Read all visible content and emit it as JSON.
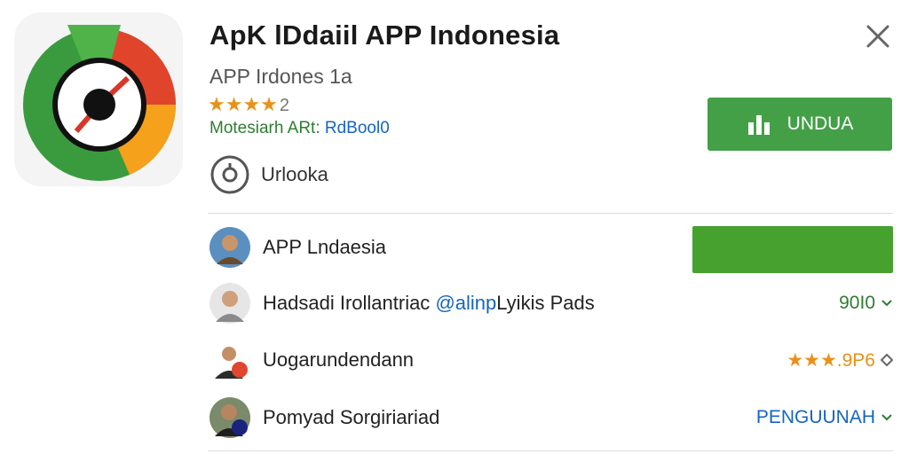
{
  "app": {
    "title": "ApK lDdaiil APP Indonesia",
    "subtitle": "APP Irdones 1a",
    "rating_stars": "★★★★",
    "rating_value": "2",
    "meta_label": "Motesiarh ARt:",
    "meta_value": "RdBool0",
    "extra_label": "Urlooka",
    "install_label": "UNDUA"
  },
  "colors": {
    "primary_green": "#43a047",
    "star_orange": "#e8911a",
    "link_blue": "#1565c0"
  },
  "list": [
    {
      "name": "APP Lndaesia",
      "handle": "",
      "suffix": "",
      "right_text": "",
      "right_icon": "",
      "action": "green-bar"
    },
    {
      "name": "Hadsadi Irollantriac ",
      "handle": "@alinp",
      "suffix": "Lyikis Pads",
      "right_text": "90I0",
      "right_icon": "chevron-down-icon"
    },
    {
      "name": "Uogarundendann",
      "handle": "",
      "suffix": "",
      "right_text": "★★★.9P6",
      "right_icon": "diamond-icon"
    },
    {
      "name": "Pomyad Sorgiriariad",
      "handle": "",
      "suffix": "",
      "right_text": "PENGUUNAH",
      "right_icon": "chevron-down-icon"
    }
  ]
}
